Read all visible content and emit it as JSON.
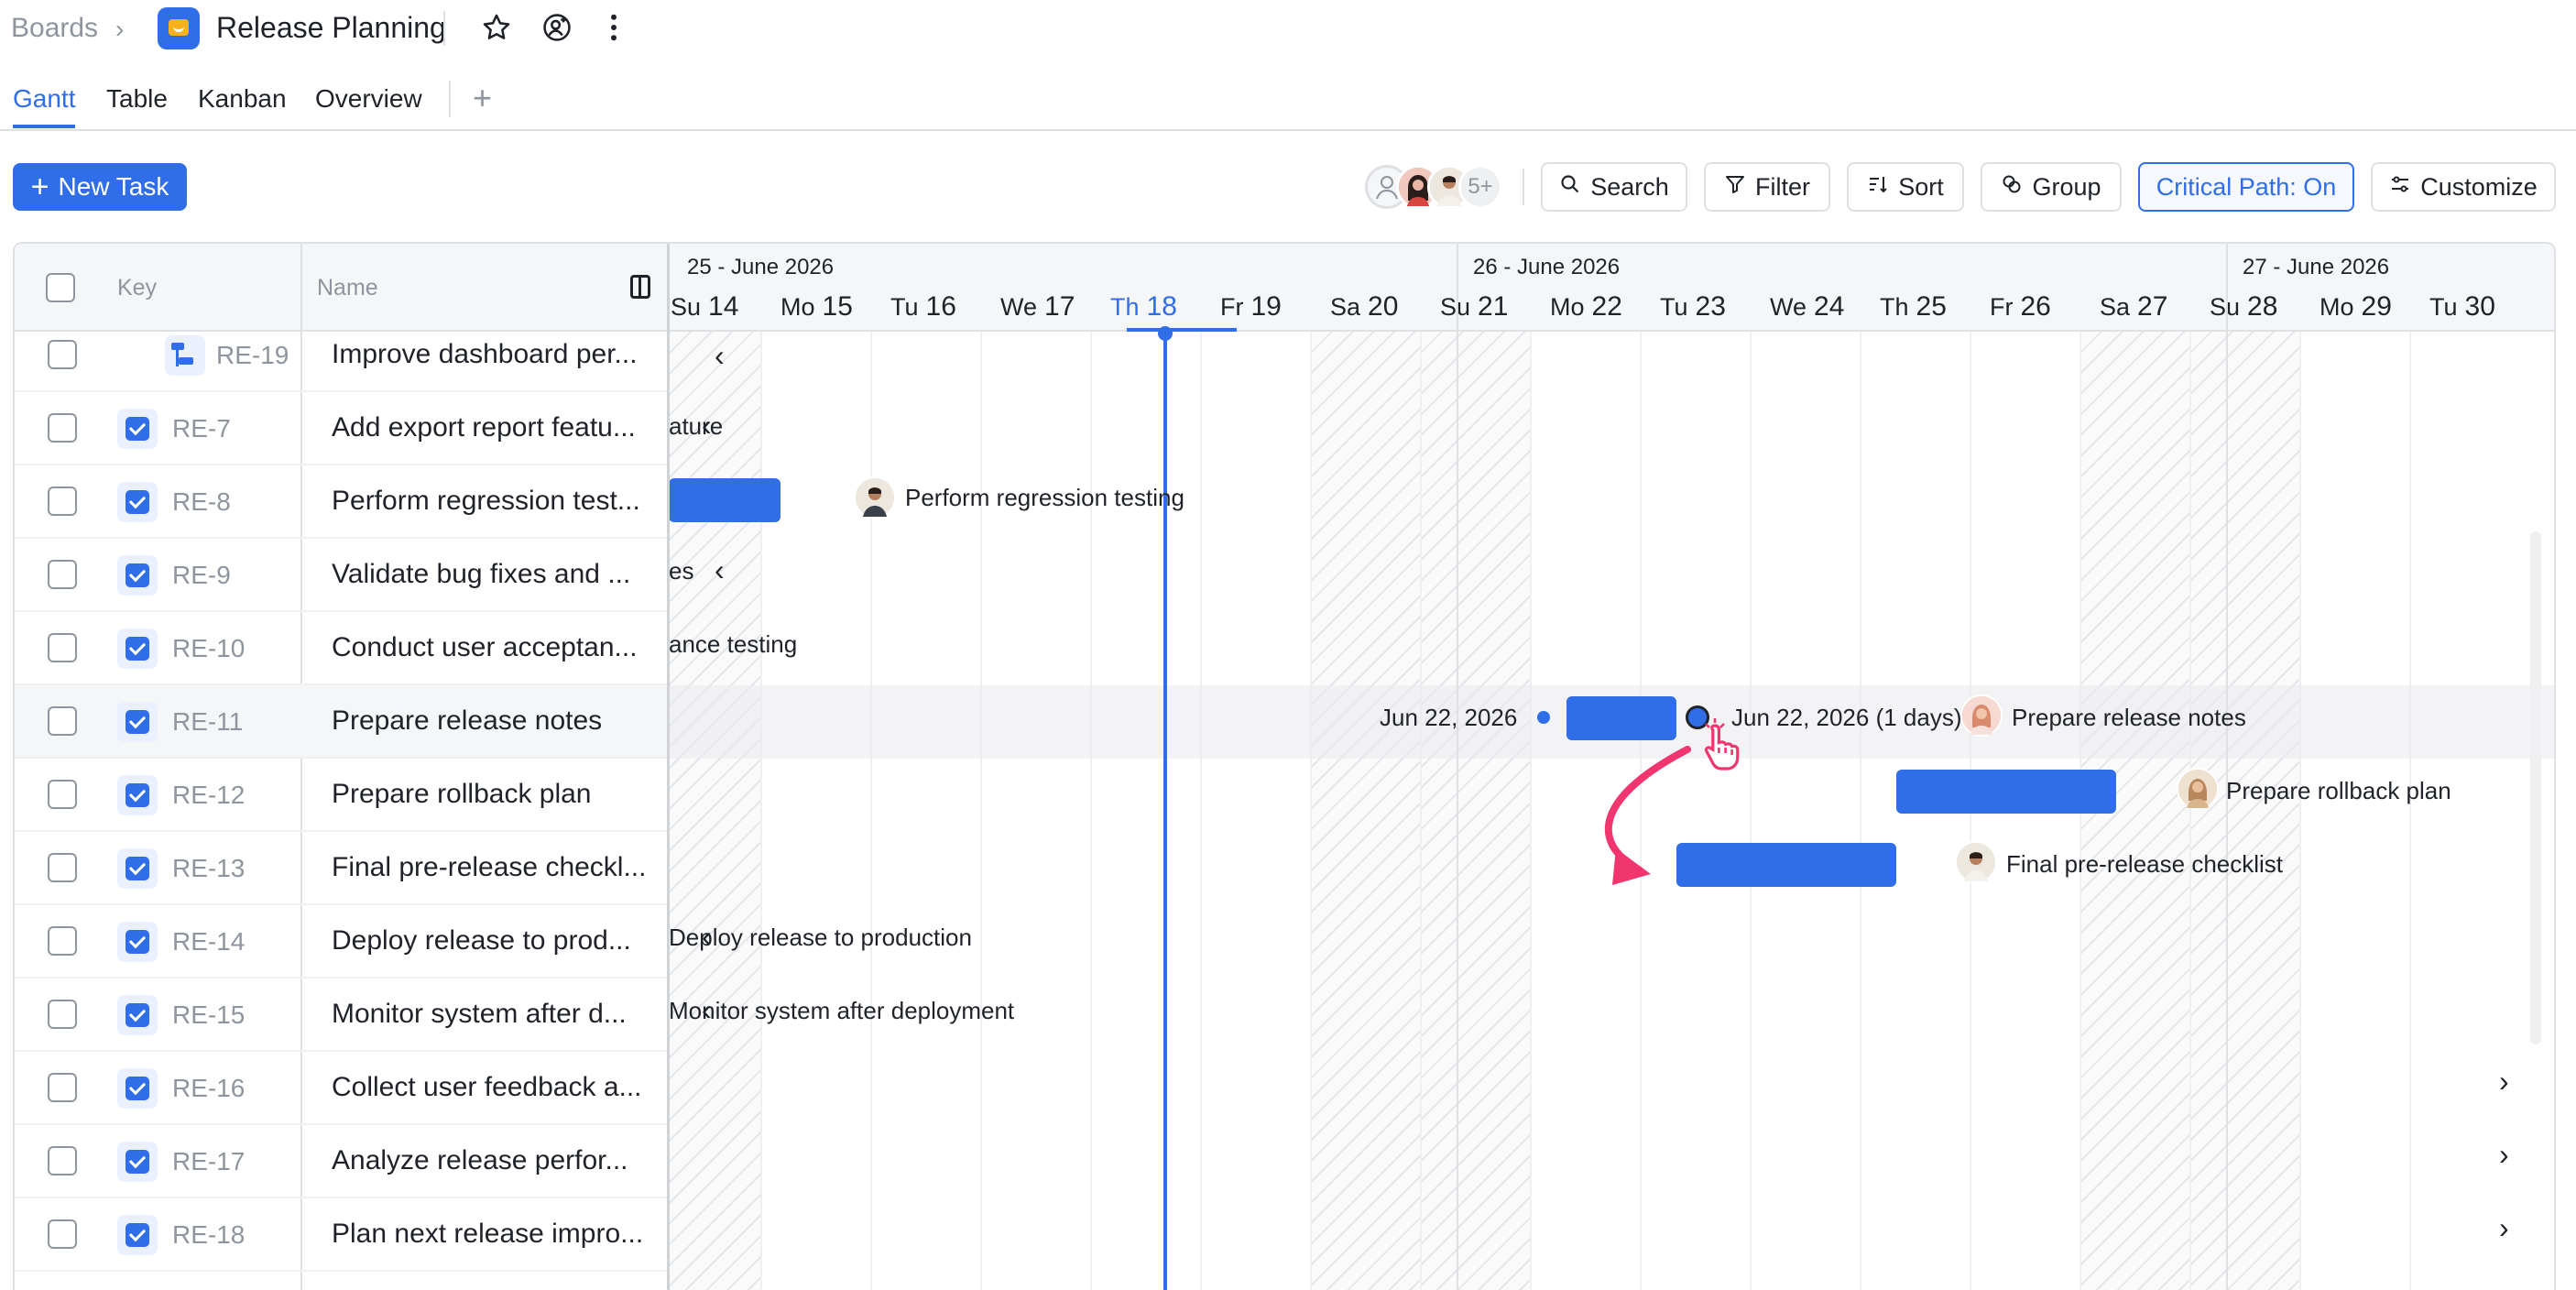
{
  "breadcrumb": {
    "root": "Boards",
    "board_title": "Release Planning"
  },
  "tabs": [
    {
      "label": "Gantt",
      "active": true
    },
    {
      "label": "Table",
      "active": false
    },
    {
      "label": "Kanban",
      "active": false
    },
    {
      "label": "Overview",
      "active": false
    }
  ],
  "toolbar": {
    "new_task_label": "New Task",
    "members_more": "5+",
    "search_label": "Search",
    "filter_label": "Filter",
    "sort_label": "Sort",
    "group_label": "Group",
    "critical_path_label": "Critical Path: On",
    "customize_label": "Customize"
  },
  "columns": {
    "key": "Key",
    "name": "Name"
  },
  "timeline": {
    "weeks": [
      "25 - June 2026",
      "26 - June 2026",
      "27 - June 2026"
    ],
    "days": [
      {
        "dow": "Su",
        "num": "14"
      },
      {
        "dow": "Mo",
        "num": "15"
      },
      {
        "dow": "Tu",
        "num": "16"
      },
      {
        "dow": "We",
        "num": "17"
      },
      {
        "dow": "Th",
        "num": "18"
      },
      {
        "dow": "Fr",
        "num": "19"
      },
      {
        "dow": "Sa",
        "num": "20"
      },
      {
        "dow": "Su",
        "num": "21"
      },
      {
        "dow": "Mo",
        "num": "22"
      },
      {
        "dow": "Tu",
        "num": "23"
      },
      {
        "dow": "We",
        "num": "24"
      },
      {
        "dow": "Th",
        "num": "25"
      },
      {
        "dow": "Fr",
        "num": "26"
      },
      {
        "dow": "Sa",
        "num": "27"
      },
      {
        "dow": "Su",
        "num": "28"
      },
      {
        "dow": "Mo",
        "num": "29"
      },
      {
        "dow": "Tu",
        "num": "30"
      }
    ],
    "today_index": 4
  },
  "rows": [
    {
      "key": "RE-19",
      "name": "Improve dashboard per...",
      "subtask": true
    },
    {
      "key": "RE-7",
      "name": "Add export report featu..."
    },
    {
      "key": "RE-8",
      "name": "Perform regression test..."
    },
    {
      "key": "RE-9",
      "name": "Validate bug fixes and ..."
    },
    {
      "key": "RE-10",
      "name": "Conduct user acceptan..."
    },
    {
      "key": "RE-11",
      "name": "Prepare release notes",
      "highlight": true
    },
    {
      "key": "RE-12",
      "name": "Prepare rollback plan"
    },
    {
      "key": "RE-13",
      "name": "Final pre-release checkl..."
    },
    {
      "key": "RE-14",
      "name": "Deploy release to prod..."
    },
    {
      "key": "RE-15",
      "name": "Monitor system after d..."
    },
    {
      "key": "RE-16",
      "name": "Collect user feedback a..."
    },
    {
      "key": "RE-17",
      "name": "Analyze release perfor..."
    },
    {
      "key": "RE-18",
      "name": "Plan next release impro..."
    }
  ],
  "gantt_labels": {
    "re7_tail": "ature",
    "re8_label": "Perform regression testing",
    "re9_tail": "es",
    "re10_tail": "ance testing",
    "re11_start": "Jun 22, 2026",
    "re11_end": "Jun 22, 2026 (1 days)",
    "re11_label": "Prepare release notes",
    "re12_label": "Prepare rollback plan",
    "re13_label": "Final pre-release checklist",
    "re14_label": "Deploy release to production",
    "re15_label": "Monitor system after deployment"
  },
  "icons": {
    "chevron_right": "›",
    "chevron_left": "‹",
    "star": "☆",
    "more": "⋮"
  },
  "colors": {
    "accent": "#2f6ee8",
    "dependency_arrow": "#f0356f",
    "weekend_hatch": "#e4e6e9"
  }
}
